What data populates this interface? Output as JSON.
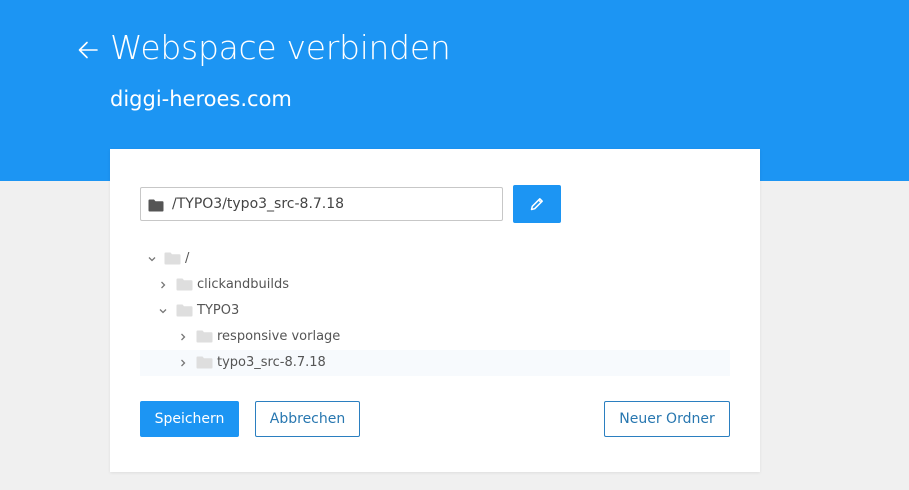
{
  "header": {
    "title": "Webspace verbinden",
    "subtitle": "diggi-heroes.com",
    "back_icon": "arrow-left-icon"
  },
  "path_field": {
    "value": "/TYPO3/typo3_src-8.7.18",
    "icon": "folder-icon"
  },
  "edit_button": {
    "icon": "pencil-icon"
  },
  "tree": {
    "items": [
      {
        "label": "/",
        "expanded": true,
        "level": 0
      },
      {
        "label": "clickandbuilds",
        "expanded": false,
        "level": 1
      },
      {
        "label": "TYPO3",
        "expanded": true,
        "level": 1
      },
      {
        "label": "responsive vorlage",
        "expanded": false,
        "level": 2
      },
      {
        "label": "typo3_src-8.7.18",
        "expanded": false,
        "level": 2,
        "selected": true
      }
    ]
  },
  "buttons": {
    "save_label": "Speichern",
    "cancel_label": "Abbrechen",
    "new_folder_label": "Neuer Ordner"
  },
  "colors": {
    "brand_blue": "#1c95f3",
    "background": "#f0f0f0",
    "outline_blue": "#2b7fc0"
  }
}
